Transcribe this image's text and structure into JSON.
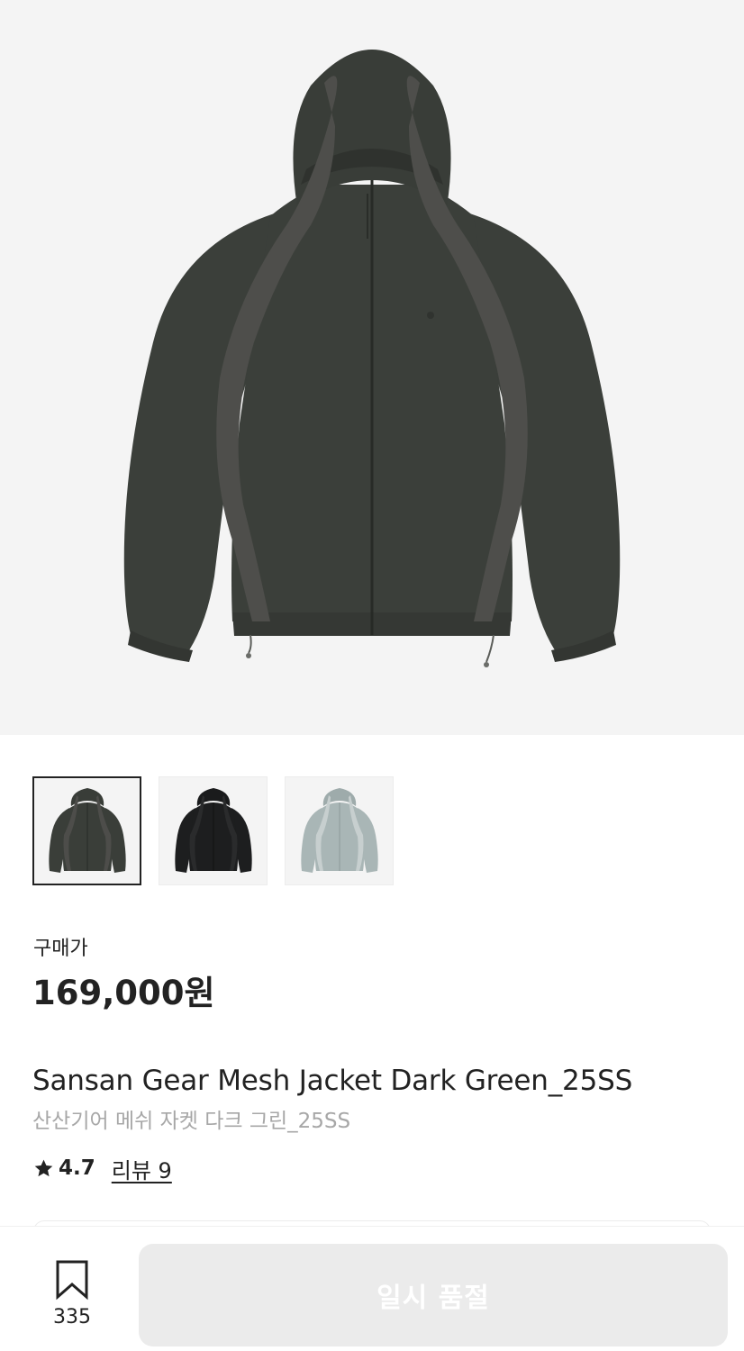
{
  "product": {
    "image_alt": "Sansan Gear Mesh Jacket Dark Green_25SS",
    "price_label": "구매가",
    "price": "169,000원",
    "title_en": "Sansan Gear Mesh Jacket Dark Green_25SS",
    "title_ko": "산산기어 메쉬 자켓 다크 그린_25SS",
    "rating": "4.7",
    "review_link": "리뷰 9"
  },
  "thumbnails": [
    {
      "color_name": "dark green",
      "body": "#3a3e39",
      "panel": "#4d4d4a",
      "selected": true
    },
    {
      "color_name": "black",
      "body": "#1d1e1f",
      "panel": "#2a2b2c",
      "selected": false
    },
    {
      "color_name": "light grey",
      "body": "#a9b6b6",
      "panel": "#c7cfcf",
      "selected": false
    }
  ],
  "bottom_bar": {
    "wish_count": "335",
    "cta_label": "일시 품절"
  },
  "colors": {
    "hero_bg": "#f4f4f4",
    "jacket_body": "#3b3f3a",
    "jacket_panel": "#4e4e4b",
    "cta_bg": "#ebebeb",
    "cta_text": "#ffffff",
    "muted_text": "#a7a7a7"
  }
}
